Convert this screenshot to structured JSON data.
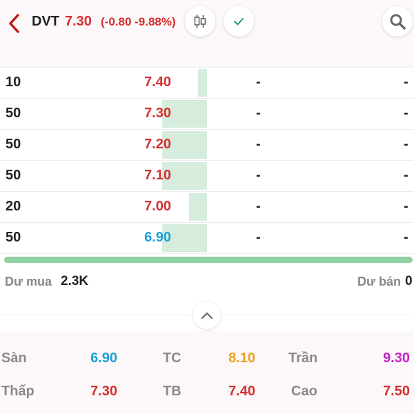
{
  "header": {
    "ticker": "DVT",
    "price": "7.30",
    "change": "(-0.80 -9.88%)",
    "icons": [
      "back-chevron-icon",
      "candlestick-icon",
      "check-icon",
      "search-icon"
    ],
    "colors": {
      "down": "#d32f2f",
      "floor": "#1aa3d4"
    }
  },
  "order_book": [
    {
      "volume": "10",
      "price": "7.40",
      "price_color": "red",
      "bar_fraction": 0.2,
      "ask_price": "-",
      "ask_volume": "-"
    },
    {
      "volume": "50",
      "price": "7.30",
      "price_color": "red",
      "bar_fraction": 1.0,
      "ask_price": "-",
      "ask_volume": "-"
    },
    {
      "volume": "50",
      "price": "7.20",
      "price_color": "red",
      "bar_fraction": 1.0,
      "ask_price": "-",
      "ask_volume": "-"
    },
    {
      "volume": "50",
      "price": "7.10",
      "price_color": "red",
      "bar_fraction": 1.0,
      "ask_price": "-",
      "ask_volume": "-"
    },
    {
      "volume": "20",
      "price": "7.00",
      "price_color": "red",
      "bar_fraction": 0.4,
      "ask_price": "-",
      "ask_volume": "-"
    },
    {
      "volume": "50",
      "price": "6.90",
      "price_color": "cyan",
      "bar_fraction": 1.0,
      "ask_price": "-",
      "ask_volume": "-"
    }
  ],
  "summary": {
    "buy_label": "Dư mua",
    "buy_value": "2.3K",
    "sell_label": "Dư bán",
    "sell_value": "0"
  },
  "stats": {
    "san_label": "Sàn",
    "san_value": "6.90",
    "tc_label": "TC",
    "tc_value": "8.10",
    "tran_label": "Trần",
    "tran_value": "9.30",
    "thap_label": "Thấp",
    "thap_value": "7.30",
    "tb_label": "TB",
    "tb_value": "7.40",
    "cao_label": "Cao",
    "cao_value": "7.50"
  }
}
